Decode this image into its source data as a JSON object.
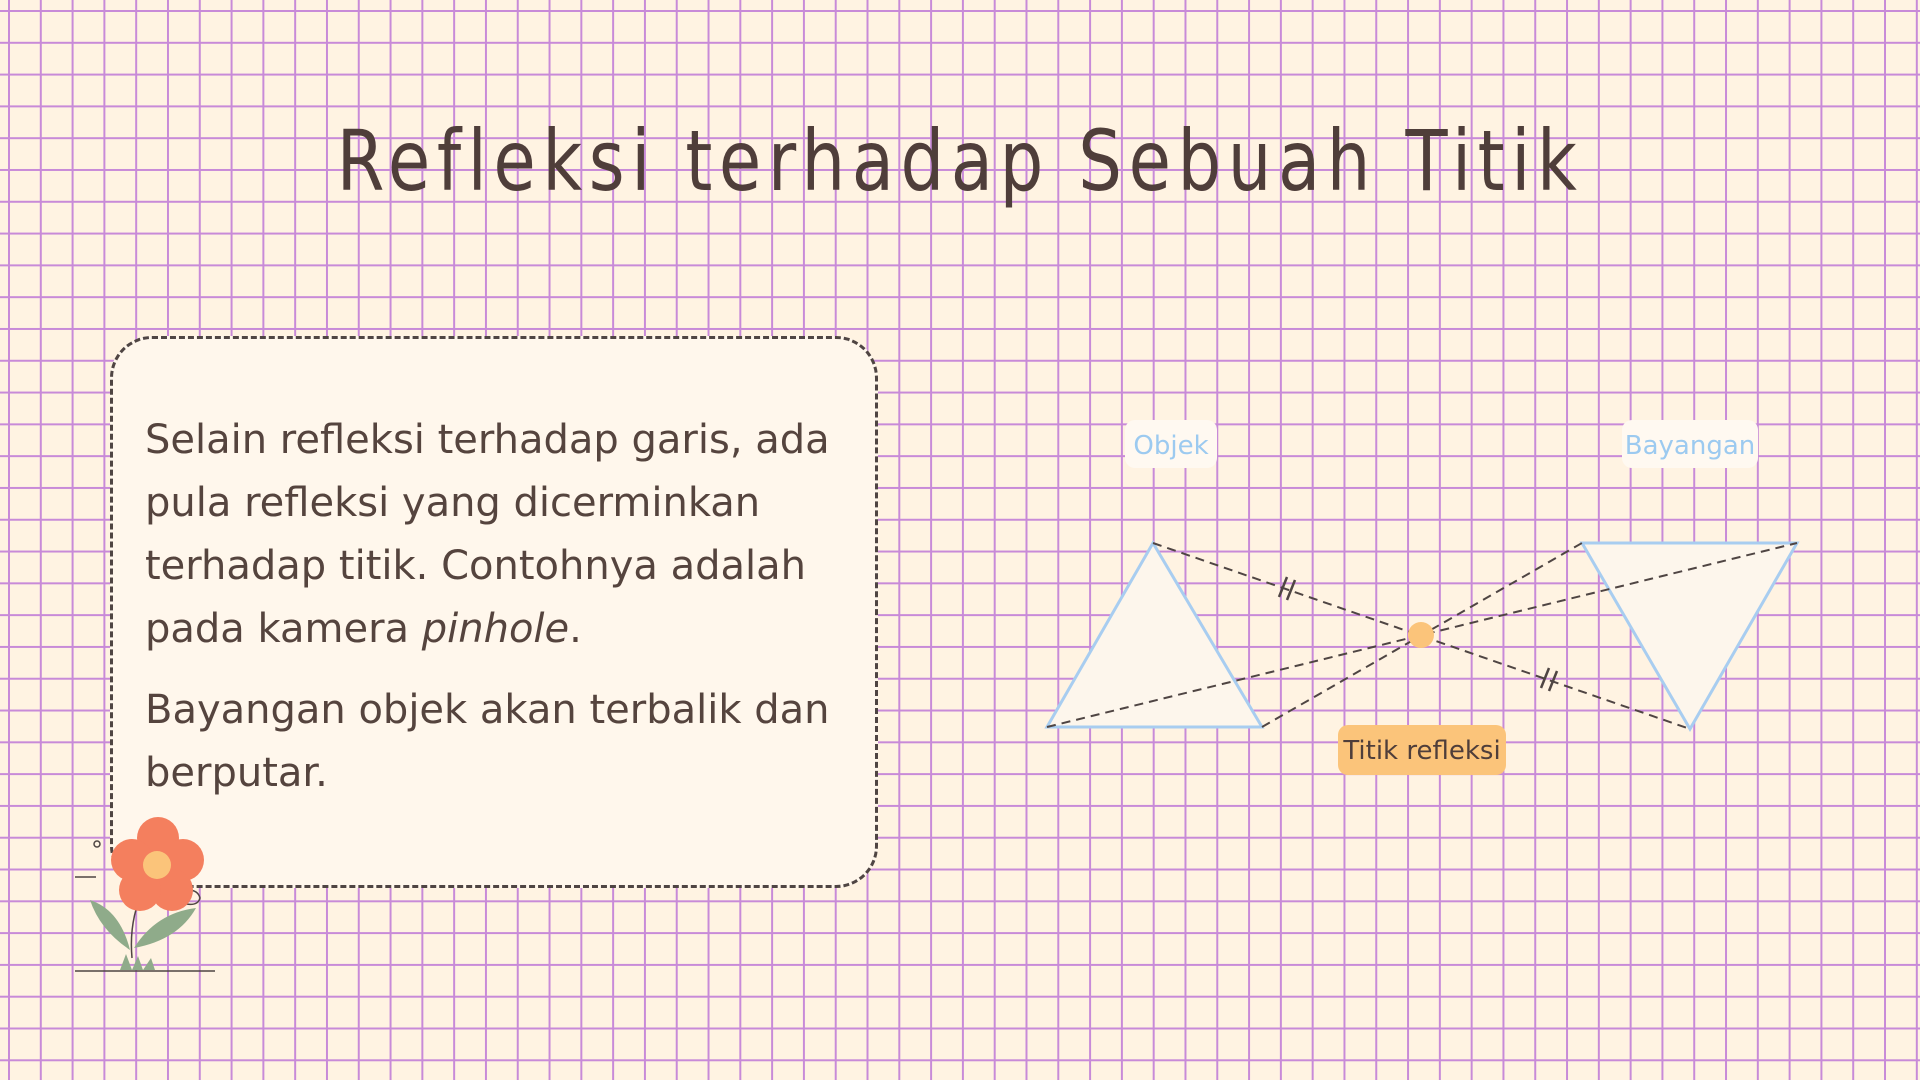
{
  "slide": {
    "title": "Refleksi terhadap Sebuah Titik"
  },
  "card": {
    "paragraph1_main": "Selain refleksi terhadap garis, ada pula refleksi yang dicerminkan terhadap titik. Contohnya adalah pada kamera ",
    "paragraph1_em": "pinhole",
    "paragraph1_end": ".",
    "paragraph2": "Bayangan objek akan terbalik dan berputar."
  },
  "diagram": {
    "object_label": "Objek",
    "image_label": "Bayangan",
    "point_label": "Titik refleksi",
    "equal_mark": "//"
  },
  "colors": {
    "background": "#fff3e2",
    "grid_line": "#c88ad8",
    "text_dark": "#4f3e3a",
    "triangle_stroke": "#a8cdf0",
    "label_blue": "#9ccaf0",
    "point_fill": "#fbc47a",
    "flower_petal": "#f47f5e",
    "flower_center": "#fbc47a",
    "leaf": "#8fab8a"
  }
}
